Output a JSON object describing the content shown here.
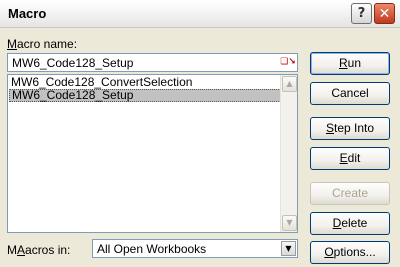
{
  "window": {
    "title": "Macro",
    "help_glyph": "?",
    "close_glyph": "✕"
  },
  "macro_name": {
    "label_prefix": "",
    "label_underline": "M",
    "label_rest": "acro name:",
    "value": "MW6_Code128_Setup",
    "ref_icon": "❏↘"
  },
  "macro_list": {
    "items": [
      {
        "label": "MW6_Code128_ConvertSelection",
        "selected": false
      },
      {
        "label": "MW6_Code128_Setup",
        "selected": true
      }
    ],
    "scroll_up": "▲",
    "scroll_down": "▼"
  },
  "macros_in": {
    "label_underline": "A",
    "label_prefix": "M",
    "label_rest": "acros in:",
    "value": "All Open Workbooks",
    "arrow": "▼"
  },
  "buttons": {
    "run": {
      "u": "R",
      "rest": "un"
    },
    "cancel": {
      "label": "Cancel"
    },
    "step_into": {
      "u": "S",
      "rest": "tep Into"
    },
    "edit": {
      "u": "E",
      "rest": "dit"
    },
    "create": {
      "u": "",
      "label": "Create"
    },
    "delete": {
      "u": "D",
      "rest": "elete"
    },
    "options": {
      "u": "O",
      "rest": "ptions..."
    }
  }
}
